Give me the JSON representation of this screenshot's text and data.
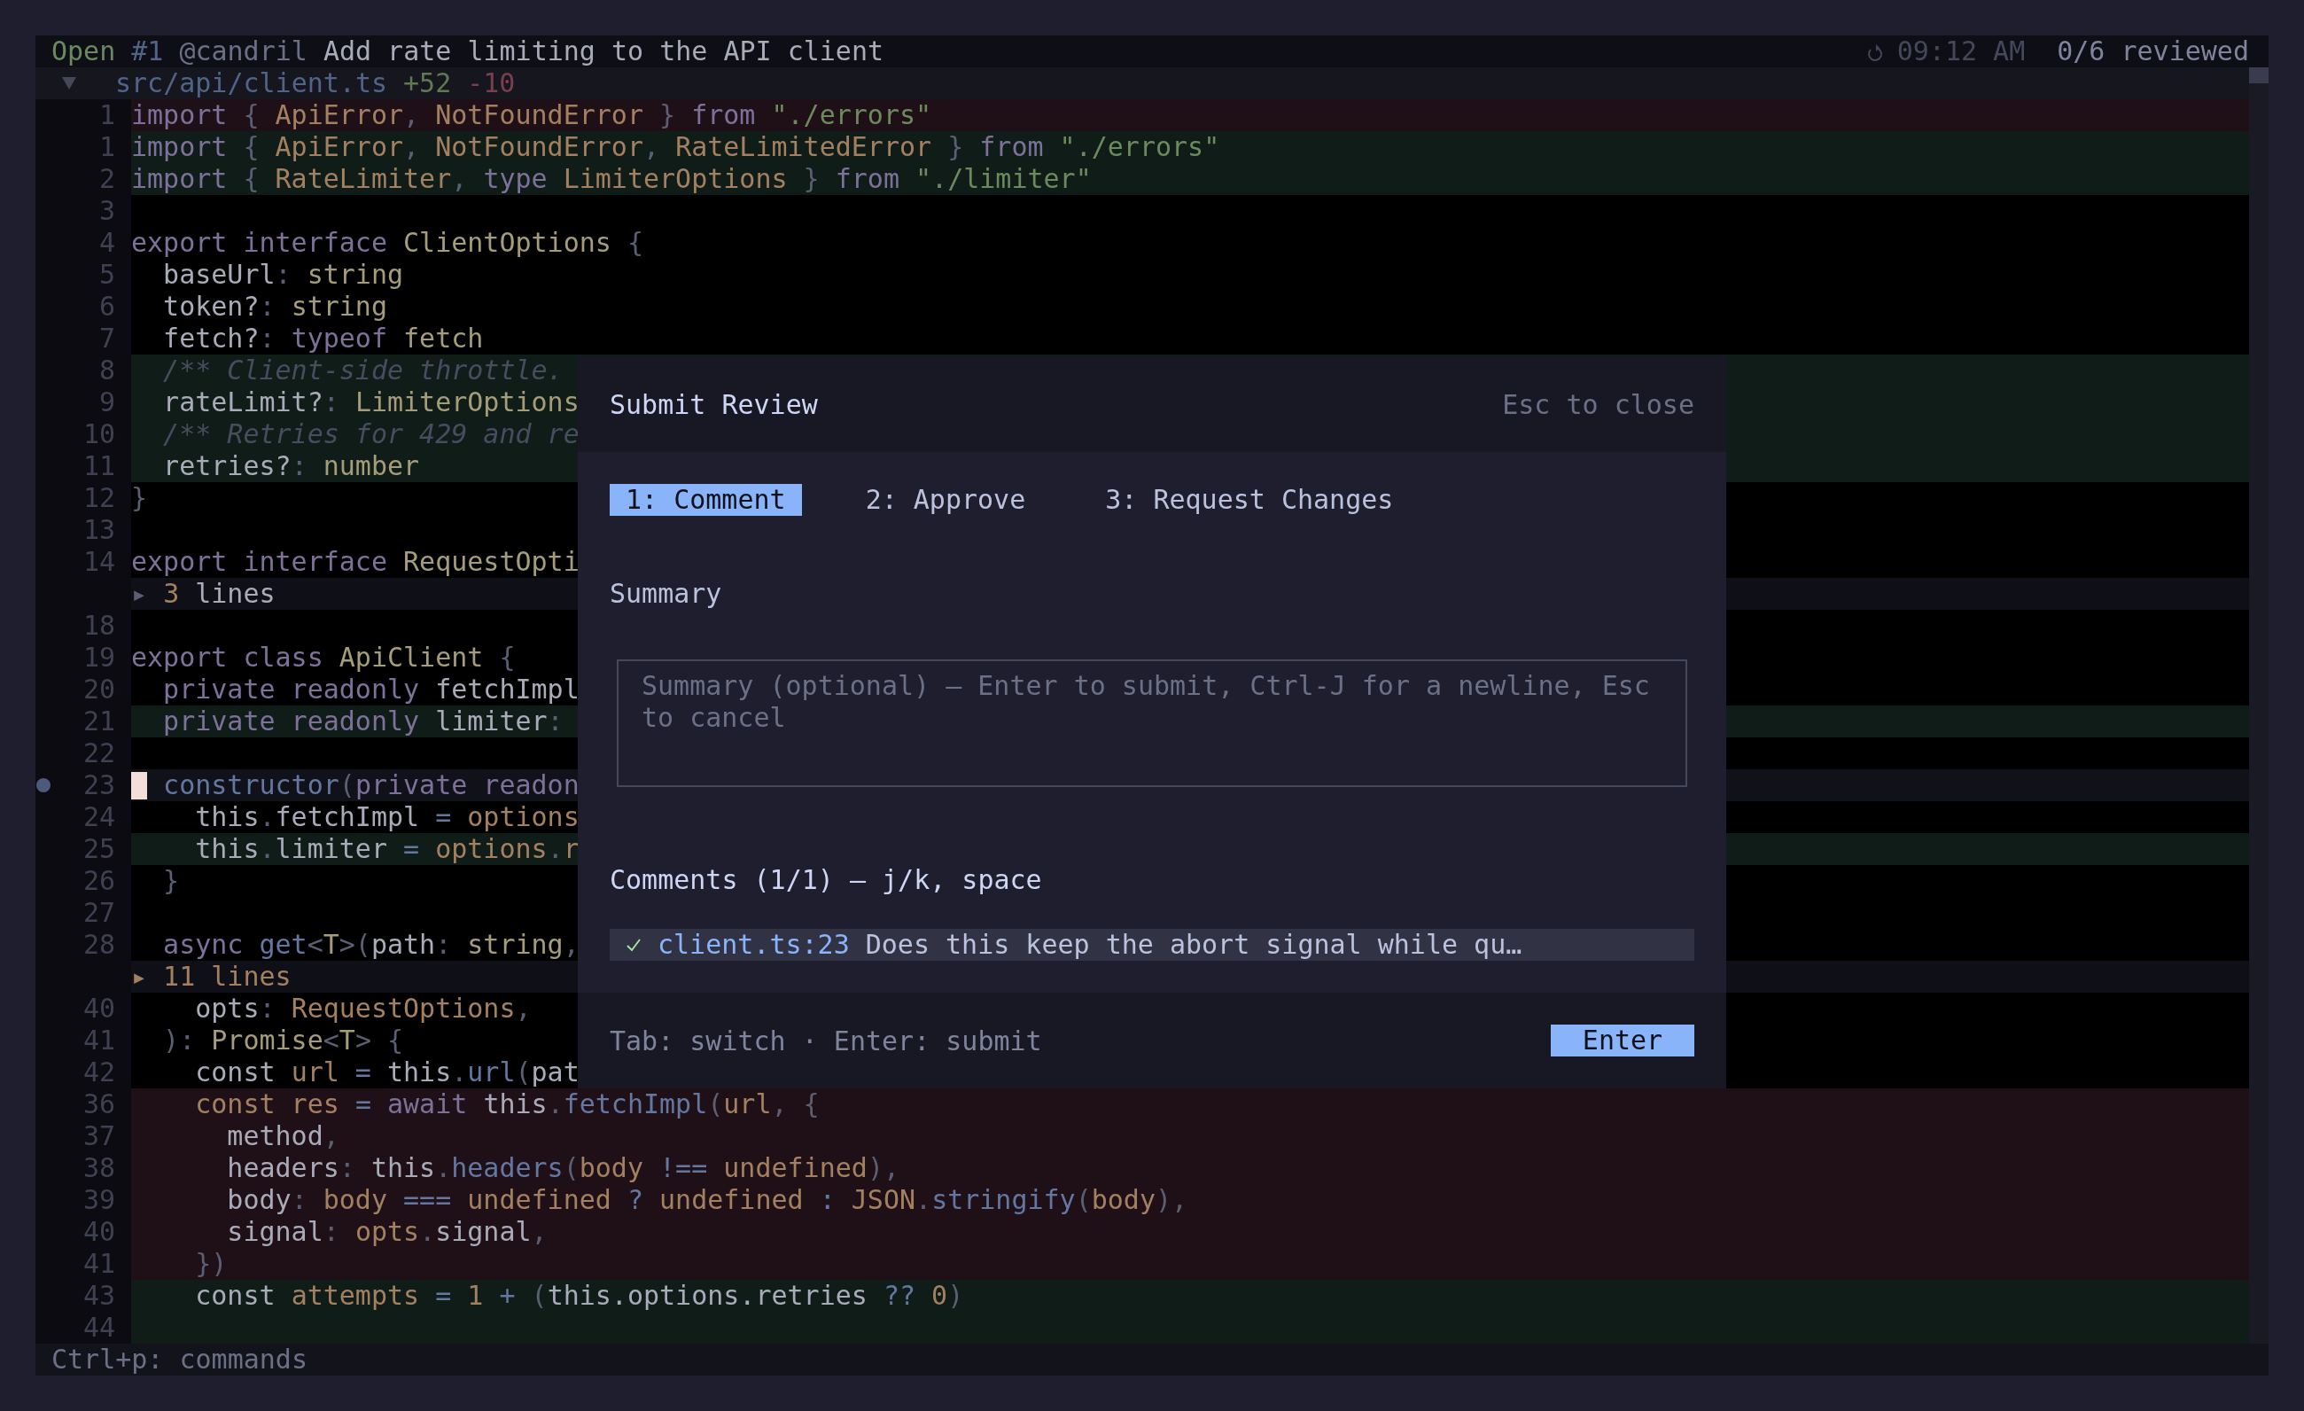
{
  "header": {
    "status": "Open",
    "number": "#1",
    "author": "@candril",
    "title": "Add rate limiting to the API client",
    "time": "09:12 AM",
    "progress": "0/6 reviewed"
  },
  "file": {
    "expanded": true,
    "path": "src/api/client.ts",
    "additions": "+52",
    "deletions": "-10"
  },
  "lines": [
    {
      "kind": "del",
      "num": "1",
      "tokens": [
        {
          "kind": "kw",
          "text": "import"
        },
        {
          "kind": "p",
          "text": " { "
        },
        {
          "kind": "id",
          "text": "ApiError"
        },
        {
          "kind": "p",
          "text": ", "
        },
        {
          "kind": "id",
          "text": "NotFoundError"
        },
        {
          "kind": "p",
          "text": " } "
        },
        {
          "kind": "kw",
          "text": "from"
        },
        {
          "kind": "str",
          "text": " \"./errors\""
        }
      ]
    },
    {
      "kind": "add",
      "num": "1",
      "tokens": [
        {
          "kind": "kw",
          "text": "import"
        },
        {
          "kind": "p",
          "text": " { "
        },
        {
          "kind": "id",
          "text": "ApiError"
        },
        {
          "kind": "p",
          "text": ", "
        },
        {
          "kind": "id",
          "text": "NotFoundError"
        },
        {
          "kind": "p",
          "text": ", "
        },
        {
          "kind": "id",
          "text": "RateLimitedError"
        },
        {
          "kind": "p",
          "text": " } "
        },
        {
          "kind": "kw",
          "text": "from"
        },
        {
          "kind": "str",
          "text": " \"./errors\""
        }
      ]
    },
    {
      "kind": "add",
      "num": "2",
      "tokens": [
        {
          "kind": "kw",
          "text": "import"
        },
        {
          "kind": "p",
          "text": " { "
        },
        {
          "kind": "id",
          "text": "RateLimiter"
        },
        {
          "kind": "p",
          "text": ", "
        },
        {
          "kind": "kw",
          "text": "type"
        },
        {
          "kind": "id",
          "text": " LimiterOptions"
        },
        {
          "kind": "p",
          "text": " } "
        },
        {
          "kind": "kw",
          "text": "from"
        },
        {
          "kind": "str",
          "text": " \"./limiter\""
        }
      ]
    },
    {
      "kind": "ctx",
      "num": "3"
    },
    {
      "kind": "ctx",
      "num": "4",
      "tokens": [
        {
          "kind": "kw",
          "text": "export interface "
        },
        {
          "kind": "ty",
          "text": "ClientOptions"
        },
        {
          "kind": "p",
          "text": " {"
        }
      ]
    },
    {
      "kind": "ctx",
      "num": "5",
      "tokens": [
        {
          "kind": "tx",
          "text": "  baseUrl"
        },
        {
          "kind": "p",
          "text": ": "
        },
        {
          "kind": "ty",
          "text": "string"
        }
      ]
    },
    {
      "kind": "ctx",
      "num": "6",
      "tokens": [
        {
          "kind": "tx",
          "text": "  token?"
        },
        {
          "kind": "p",
          "text": ": "
        },
        {
          "kind": "ty",
          "text": "string"
        }
      ]
    },
    {
      "kind": "ctx",
      "num": "7",
      "tokens": [
        {
          "kind": "tx",
          "text": "  fetch?"
        },
        {
          "kind": "p",
          "text": ": "
        },
        {
          "kind": "kw",
          "text": "typeof "
        },
        {
          "kind": "ty",
          "text": "fetch"
        }
      ]
    },
    {
      "kind": "add",
      "num": "8",
      "tokens": [
        {
          "kind": "cm",
          "text": "  /** Client-side throttle."
        }
      ]
    },
    {
      "kind": "add",
      "num": "9",
      "tokens": [
        {
          "kind": "tx",
          "text": "  rateLimit?"
        },
        {
          "kind": "p",
          "text": ": "
        },
        {
          "kind": "ty",
          "text": "LimiterOptions"
        }
      ]
    },
    {
      "kind": "add",
      "num": "10",
      "tokens": [
        {
          "kind": "cm",
          "text": "  /** Retries for 429 and re"
        }
      ]
    },
    {
      "kind": "add",
      "num": "11",
      "tokens": [
        {
          "kind": "tx",
          "text": "  retries?"
        },
        {
          "kind": "p",
          "text": ": "
        },
        {
          "kind": "ty",
          "text": "number"
        }
      ]
    },
    {
      "kind": "ctx",
      "num": "12",
      "tokens": [
        {
          "kind": "p",
          "text": "}"
        }
      ]
    },
    {
      "kind": "ctx",
      "num": "13"
    },
    {
      "kind": "ctx",
      "num": "14",
      "tokens": [
        {
          "kind": "kw",
          "text": "export interface "
        },
        {
          "kind": "ty",
          "text": "RequestOpti"
        }
      ]
    },
    {
      "kind": "fold",
      "tokens": [
        {
          "kind": "p",
          "text": "▸ "
        },
        {
          "kind": "id",
          "text": "3"
        },
        {
          "kind": "tx",
          "text": " lines"
        }
      ]
    },
    {
      "kind": "ctx",
      "num": "18"
    },
    {
      "kind": "ctx",
      "num": "19",
      "tokens": [
        {
          "kind": "kw",
          "text": "export class "
        },
        {
          "kind": "ty",
          "text": "ApiClient"
        },
        {
          "kind": "p",
          "text": " {"
        }
      ]
    },
    {
      "kind": "ctx",
      "num": "20",
      "tokens": [
        {
          "kind": "kw",
          "text": "  private readonly "
        },
        {
          "kind": "tx",
          "text": "fetchImpl"
        }
      ]
    },
    {
      "kind": "add",
      "num": "21",
      "tokens": [
        {
          "kind": "kw",
          "text": "  private readonly "
        },
        {
          "kind": "tx",
          "text": "limiter"
        },
        {
          "kind": "p",
          "text": ":"
        }
      ]
    },
    {
      "kind": "ctx",
      "num": "22"
    },
    {
      "kind": "ctx",
      "num": "23",
      "cursor": true,
      "commented": true,
      "tokens": [
        {
          "kind": "fn",
          "text": "  constructor"
        },
        {
          "kind": "p",
          "text": "("
        },
        {
          "kind": "kw",
          "text": "private readon"
        }
      ]
    },
    {
      "kind": "ctx",
      "num": "24",
      "tokens": [
        {
          "kind": "tx",
          "text": "    this"
        },
        {
          "kind": "p",
          "text": "."
        },
        {
          "kind": "tx",
          "text": "fetchImpl "
        },
        {
          "kind": "op",
          "text": "="
        },
        {
          "kind": "id",
          "text": " options"
        }
      ]
    },
    {
      "kind": "add",
      "num": "25",
      "tokens": [
        {
          "kind": "tx",
          "text": "    this"
        },
        {
          "kind": "p",
          "text": "."
        },
        {
          "kind": "tx",
          "text": "limiter "
        },
        {
          "kind": "op",
          "text": "="
        },
        {
          "kind": "id",
          "text": " options"
        },
        {
          "kind": "p",
          "text": "."
        },
        {
          "kind": "id",
          "text": "r"
        }
      ]
    },
    {
      "kind": "ctx",
      "num": "26",
      "tokens": [
        {
          "kind": "p",
          "text": "  }"
        }
      ]
    },
    {
      "kind": "ctx",
      "num": "27"
    },
    {
      "kind": "ctx",
      "num": "28",
      "tokens": [
        {
          "kind": "kw",
          "text": "  async "
        },
        {
          "kind": "fn",
          "text": "get"
        },
        {
          "kind": "p",
          "text": "<"
        },
        {
          "kind": "ty",
          "text": "T"
        },
        {
          "kind": "p",
          "text": ">("
        },
        {
          "kind": "tx",
          "text": "path"
        },
        {
          "kind": "p",
          "text": ": "
        },
        {
          "kind": "ty",
          "text": "string"
        },
        {
          "kind": "p",
          "text": ","
        }
      ]
    },
    {
      "kind": "fold",
      "tokens": [
        {
          "kind": "id",
          "text": "▸ 11 lines"
        }
      ]
    },
    {
      "kind": "ctx",
      "num": "40",
      "tokens": [
        {
          "kind": "tx",
          "text": "    opts"
        },
        {
          "kind": "p",
          "text": ": "
        },
        {
          "kind": "id",
          "text": "RequestOptions"
        },
        {
          "kind": "p",
          "text": ","
        }
      ]
    },
    {
      "kind": "ctx",
      "num": "41",
      "tokens": [
        {
          "kind": "p",
          "text": "  ): "
        },
        {
          "kind": "ty",
          "text": "Promise"
        },
        {
          "kind": "p",
          "text": "<"
        },
        {
          "kind": "ty",
          "text": "T"
        },
        {
          "kind": "p",
          "text": "> {"
        }
      ]
    },
    {
      "kind": "ctx",
      "num": "42",
      "tokens": [
        {
          "kind": "tx",
          "text": "    const "
        },
        {
          "kind": "id",
          "text": "url"
        },
        {
          "kind": "op",
          "text": " = "
        },
        {
          "kind": "tx",
          "text": "this"
        },
        {
          "kind": "p",
          "text": "."
        },
        {
          "kind": "fn",
          "text": "url"
        },
        {
          "kind": "p",
          "text": "("
        },
        {
          "kind": "tx",
          "text": "pat"
        }
      ]
    },
    {
      "kind": "del",
      "num": "36",
      "tokens": [
        {
          "kind": "id",
          "text": "    const res "
        },
        {
          "kind": "op",
          "text": "= "
        },
        {
          "kind": "kw",
          "text": "await "
        },
        {
          "kind": "tx",
          "text": "this"
        },
        {
          "kind": "p",
          "text": "."
        },
        {
          "kind": "fn",
          "text": "fetchImpl"
        },
        {
          "kind": "p",
          "text": "("
        },
        {
          "kind": "id",
          "text": "url"
        },
        {
          "kind": "p",
          "text": ", {"
        }
      ]
    },
    {
      "kind": "del",
      "num": "37",
      "tokens": [
        {
          "kind": "tx",
          "text": "      method"
        },
        {
          "kind": "p",
          "text": ","
        }
      ]
    },
    {
      "kind": "del",
      "num": "38",
      "tokens": [
        {
          "kind": "tx",
          "text": "      headers"
        },
        {
          "kind": "p",
          "text": ": "
        },
        {
          "kind": "tx",
          "text": "this"
        },
        {
          "kind": "p",
          "text": "."
        },
        {
          "kind": "fn",
          "text": "headers"
        },
        {
          "kind": "p",
          "text": "("
        },
        {
          "kind": "id",
          "text": "body "
        },
        {
          "kind": "op",
          "text": "!=="
        },
        {
          "kind": "id",
          "text": " undefined"
        },
        {
          "kind": "p",
          "text": "),"
        }
      ]
    },
    {
      "kind": "del",
      "num": "39",
      "tokens": [
        {
          "kind": "tx",
          "text": "      body"
        },
        {
          "kind": "p",
          "text": ": "
        },
        {
          "kind": "id",
          "text": "body "
        },
        {
          "kind": "op",
          "text": "==="
        },
        {
          "kind": "id",
          "text": " undefined "
        },
        {
          "kind": "op",
          "text": "?"
        },
        {
          "kind": "id",
          "text": " undefined "
        },
        {
          "kind": "op",
          "text": ":"
        },
        {
          "kind": "id",
          "text": " JSON"
        },
        {
          "kind": "p",
          "text": "."
        },
        {
          "kind": "fn",
          "text": "stringify"
        },
        {
          "kind": "p",
          "text": "("
        },
        {
          "kind": "id",
          "text": "body"
        },
        {
          "kind": "p",
          "text": "),"
        }
      ]
    },
    {
      "kind": "del",
      "num": "40",
      "tokens": [
        {
          "kind": "tx",
          "text": "      signal"
        },
        {
          "kind": "p",
          "text": ": "
        },
        {
          "kind": "id",
          "text": "opts"
        },
        {
          "kind": "p",
          "text": "."
        },
        {
          "kind": "tx",
          "text": "signal"
        },
        {
          "kind": "p",
          "text": ","
        }
      ]
    },
    {
      "kind": "del",
      "num": "41",
      "tokens": [
        {
          "kind": "p",
          "text": "    })"
        }
      ]
    },
    {
      "kind": "add",
      "num": "43",
      "tokens": [
        {
          "kind": "tx",
          "text": "    const "
        },
        {
          "kind": "id",
          "text": "attempts "
        },
        {
          "kind": "op",
          "text": "= "
        },
        {
          "kind": "id",
          "text": "1 "
        },
        {
          "kind": "op",
          "text": "+ "
        },
        {
          "kind": "p",
          "text": "("
        },
        {
          "kind": "tx",
          "text": "this.options.retries "
        },
        {
          "kind": "op",
          "text": "??"
        },
        {
          "kind": "id",
          "text": " 0"
        },
        {
          "kind": "p",
          "text": ")"
        }
      ]
    },
    {
      "kind": "add",
      "num": "44"
    }
  ],
  "status_bar": "Ctrl+p: commands",
  "dialog": {
    "title": "Submit Review",
    "close_hint": "Esc to close",
    "tabs": [
      {
        "label": "1: Comment",
        "selected": true
      },
      {
        "label": "2: Approve",
        "selected": false
      },
      {
        "label": "3: Request Changes",
        "selected": false
      }
    ],
    "summary_label": "Summary",
    "summary": {
      "placeholder": "Summary (optional) — Enter to submit, Ctrl-J for a newline, Esc to cancel"
    },
    "comments_label": "Comments (1/1) — j/k, space",
    "comments": [
      {
        "checked": true,
        "selected": true,
        "location": "client.ts:23",
        "text": "Does this keep the abort signal while qu…"
      }
    ],
    "footer_hint": "Tab: switch · Enter: submit",
    "submit_button": "Enter"
  }
}
